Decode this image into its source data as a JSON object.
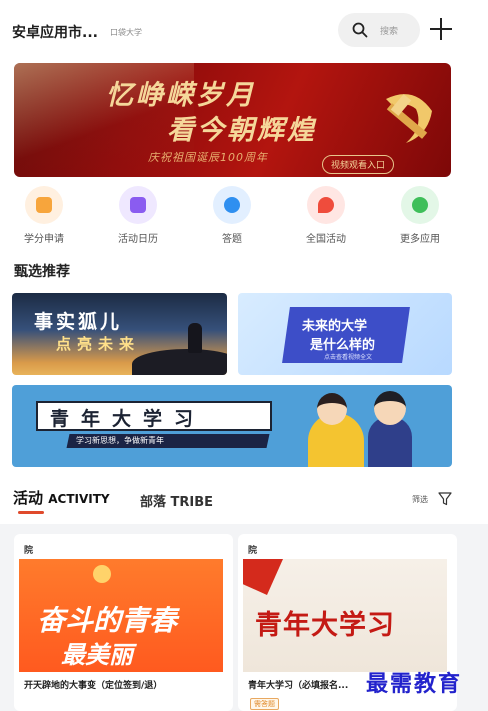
{
  "header": {
    "title": "安卓应用市...",
    "school": "口袋大学",
    "search_placeholder": "搜索"
  },
  "banner": {
    "line1": "忆峥嵘岁月",
    "line2": "看今朝辉煌",
    "line3": "庆祝祖国诞辰100周年",
    "watch_label": "视频观看入口"
  },
  "quick_actions": [
    {
      "label": "学分申请",
      "color": "#f7a53c",
      "bg": "#fff0e0"
    },
    {
      "label": "活动日历",
      "color": "#8a5cf0",
      "bg": "#efe8ff"
    },
    {
      "label": "答题",
      "color": "#2f8ff0",
      "bg": "#e2efff"
    },
    {
      "label": "全国活动",
      "color": "#ef4c3c",
      "bg": "#ffe6e3"
    },
    {
      "label": "更多应用",
      "color": "#3fbf5a",
      "bg": "#e3f7e7"
    }
  ],
  "section_title": "甄选推荐",
  "recommend": {
    "card1": {
      "line1": "事实狐儿",
      "line2": "点亮未来"
    },
    "card2": {
      "line1": "未来的大学",
      "line2": "是什么样的",
      "line3": "点击查看视频全文"
    },
    "card3": {
      "title": "青年大学习",
      "subtitle": "学习新思想，争做新青年"
    }
  },
  "tabs": {
    "active_cn": "活动",
    "active_en": "ACTIVITY",
    "other": "部落 TRIBE",
    "filter": "筛选"
  },
  "activities": [
    {
      "tag": "院",
      "art1": "奋斗的青春",
      "art2": "最美丽",
      "caption": "开天辟地的大事变（定位签到/退）"
    },
    {
      "tag": "院",
      "art": "青年大学习",
      "caption": "青年大学习（必填报名...",
      "badge": "需答题"
    }
  ],
  "watermark": "最需教育"
}
